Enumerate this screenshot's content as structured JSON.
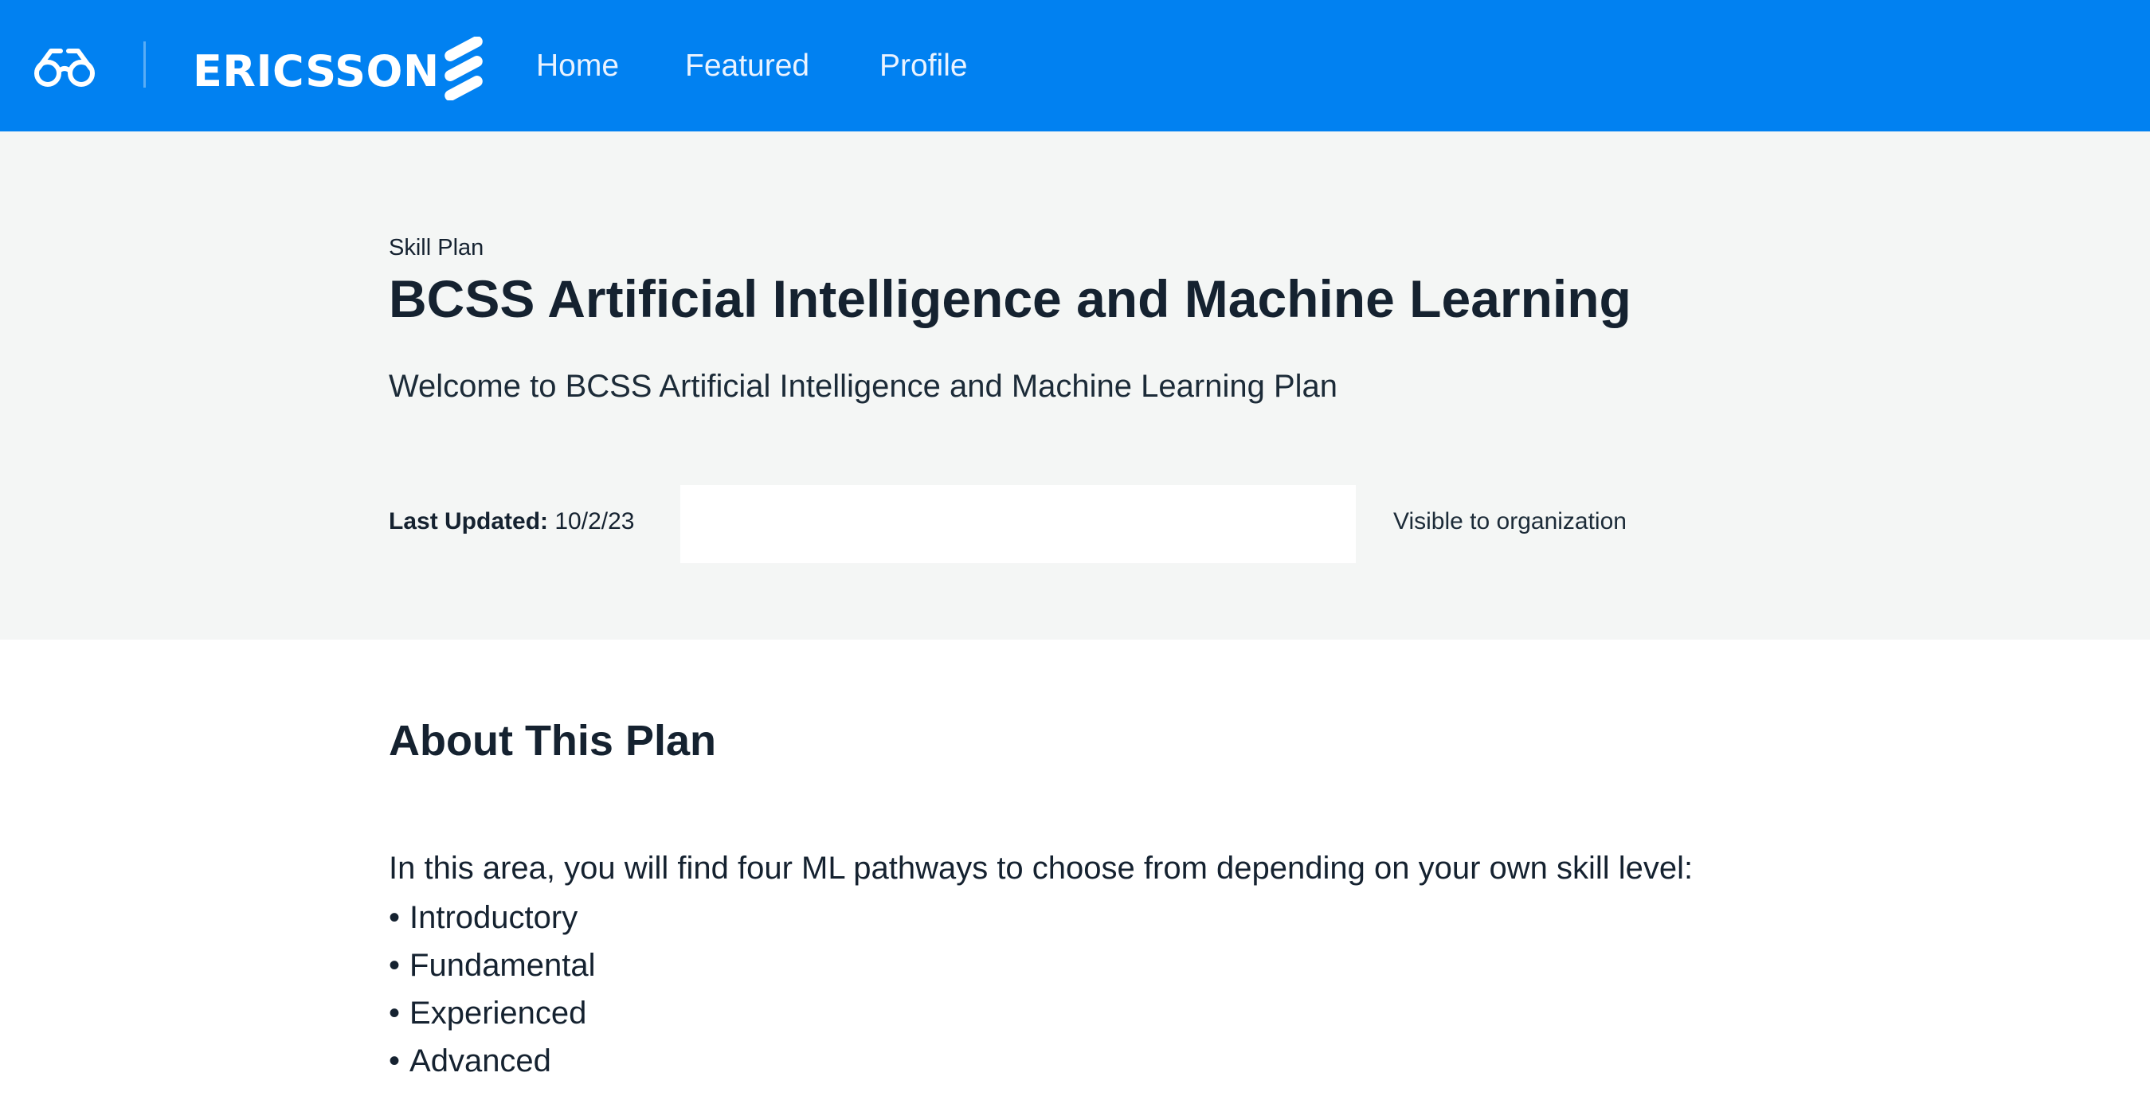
{
  "colors": {
    "topbar": "#0181f1",
    "hero_background": "#f4f6f5",
    "text_primary": "#152230",
    "nav_text": "#eaf3ff"
  },
  "header": {
    "logo_icon": "glasses-icon",
    "brand_name": "ERICSSON",
    "brand_mark_icon": "ericsson-logo-mark",
    "nav": [
      {
        "label": "Home"
      },
      {
        "label": "Featured"
      },
      {
        "label": "Profile"
      }
    ]
  },
  "hero": {
    "eyebrow": "Skill Plan",
    "title": "BCSS Artificial Intelligence and Machine Learning",
    "subtitle": "Welcome to BCSS Artificial Intelligence and Machine Learning Plan",
    "last_updated_label": "Last Updated:",
    "last_updated_value": "10/2/23",
    "visibility": "Visible to organization"
  },
  "about": {
    "heading": "About This Plan",
    "intro": "In this area, you will find four ML pathways to choose from depending on your own skill level:",
    "bullet_symbol": "•",
    "pathways": [
      {
        "label": "Introductory"
      },
      {
        "label": "Fundamental"
      },
      {
        "label": "Experienced"
      },
      {
        "label": "Advanced"
      }
    ]
  }
}
